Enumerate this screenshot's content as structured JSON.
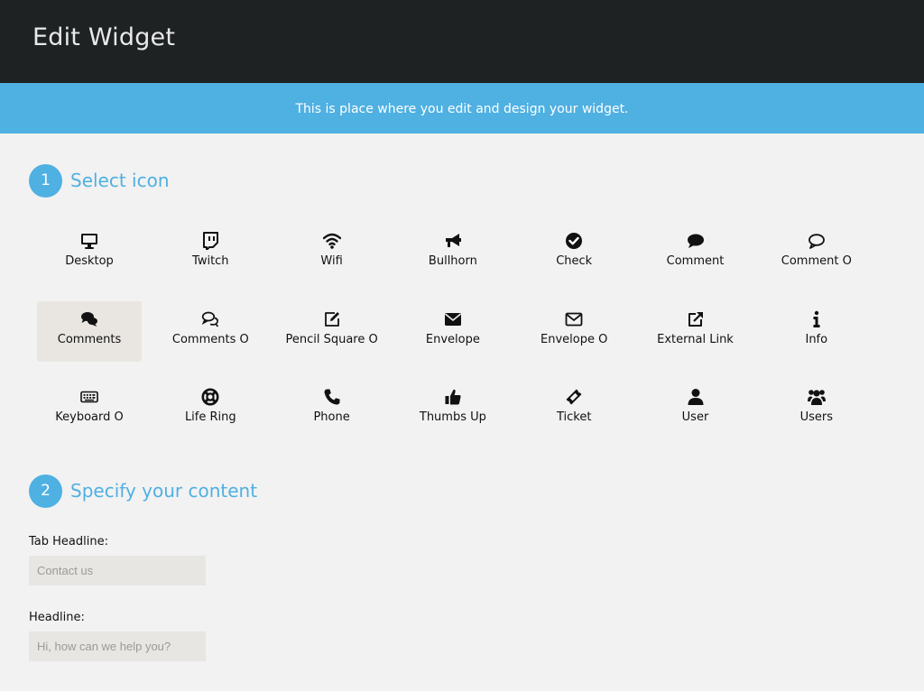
{
  "header": {
    "title": "Edit Widget"
  },
  "banner": {
    "text": "This is place where you edit and design your widget."
  },
  "step1": {
    "number": "1",
    "title": "Select icon"
  },
  "step2": {
    "number": "2",
    "title": "Specify your content"
  },
  "icons": [
    {
      "label": "Desktop",
      "icon": "desktop-icon"
    },
    {
      "label": "Twitch",
      "icon": "twitch-icon"
    },
    {
      "label": "Wifi",
      "icon": "wifi-icon"
    },
    {
      "label": "Bullhorn",
      "icon": "bullhorn-icon"
    },
    {
      "label": "Check",
      "icon": "check-icon"
    },
    {
      "label": "Comment",
      "icon": "comment-icon"
    },
    {
      "label": "Comment O",
      "icon": "comment-o-icon"
    },
    {
      "label": "Comments",
      "icon": "comments-icon",
      "selected": true
    },
    {
      "label": "Comments O",
      "icon": "comments-o-icon"
    },
    {
      "label": "Pencil Square O",
      "icon": "pencil-square-o-icon"
    },
    {
      "label": "Envelope",
      "icon": "envelope-icon"
    },
    {
      "label": "Envelope O",
      "icon": "envelope-o-icon"
    },
    {
      "label": "External Link",
      "icon": "external-link-icon"
    },
    {
      "label": "Info",
      "icon": "info-icon"
    },
    {
      "label": "Keyboard O",
      "icon": "keyboard-o-icon"
    },
    {
      "label": "Life Ring",
      "icon": "life-ring-icon"
    },
    {
      "label": "Phone",
      "icon": "phone-icon"
    },
    {
      "label": "Thumbs Up",
      "icon": "thumbs-up-icon"
    },
    {
      "label": "Ticket",
      "icon": "ticket-icon"
    },
    {
      "label": "User",
      "icon": "user-icon"
    },
    {
      "label": "Users",
      "icon": "users-icon"
    }
  ],
  "form": {
    "tab_headline": {
      "label": "Tab Headline:",
      "placeholder": "Contact us"
    },
    "headline": {
      "label": "Headline:",
      "placeholder": "Hi, how can we help you?"
    }
  },
  "colors": {
    "accent": "#4fb0e2",
    "header_bg": "#1e2223",
    "selected_bg": "#e9e6e2"
  }
}
